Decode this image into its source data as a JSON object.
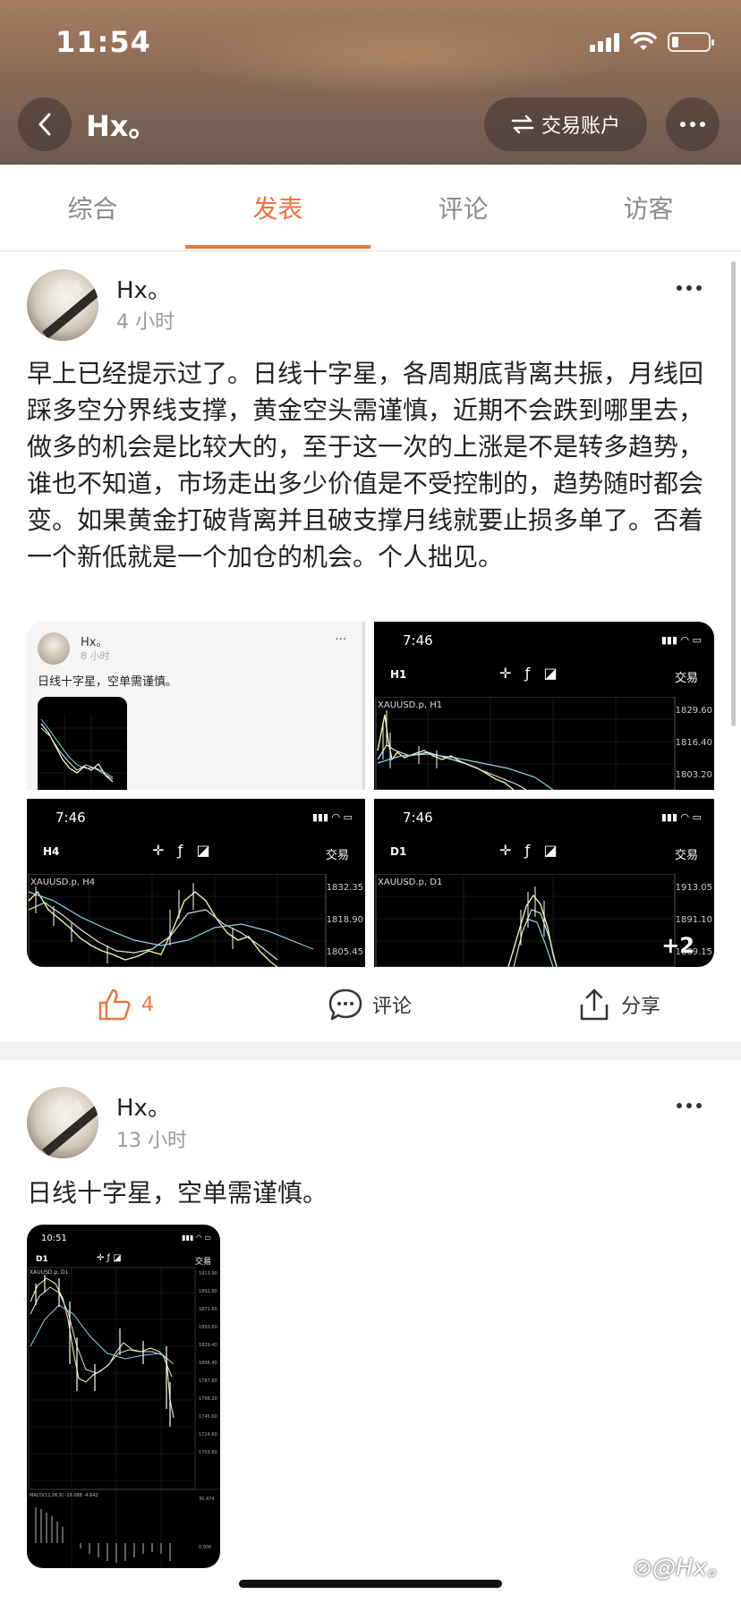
{
  "status_bar": {
    "time": "11:54"
  },
  "header": {
    "title": "Hx。",
    "account_button": "交易账户"
  },
  "tabs": [
    {
      "label": "综合"
    },
    {
      "label": "发表"
    },
    {
      "label": "评论"
    },
    {
      "label": "访客"
    }
  ],
  "active_tab": "发表",
  "posts": [
    {
      "user": "Hx。",
      "time": "4 小时",
      "text": "早上已经提示过了。日线十字星，各周期底背离共振，月线回踩多空分界线支撑，黄金空头需谨慎，近期不会跌到哪里去，做多的机会是比较大的，至于这一次的上涨是不是转多趋势，谁也不知道，市场走出多少价值是不受控制的，趋势随时都会变。如果黄金打破背离并且破支撑月线就要止损多单了。否着一个新低就是一个加仓的机会。个人拙见。",
      "images": [
        {
          "type": "post-screenshot",
          "user": "Hx。",
          "time": "8 小时",
          "text": "日线十字星，空单需谨慎。"
        },
        {
          "type": "chart",
          "clock": "7:46",
          "period": "H1",
          "symbol": "XAUUSD.p, H1",
          "trade": "交易",
          "prices": [
            "1829.60",
            "1816.40",
            "1803.20"
          ]
        },
        {
          "type": "chart",
          "clock": "7:46",
          "period": "H4",
          "symbol": "XAUUSD.p, H4",
          "trade": "交易",
          "prices": [
            "1832.35",
            "1818.90",
            "1805.45"
          ]
        },
        {
          "type": "chart",
          "clock": "7:46",
          "period": "D1",
          "symbol": "XAUUSD.p, D1",
          "trade": "交易",
          "prices": [
            "1913.05",
            "1891.10",
            "1869.15"
          ],
          "more": "+2"
        }
      ],
      "likes": "4",
      "comment_label": "评论",
      "share_label": "分享"
    },
    {
      "user": "Hx。",
      "time": "13 小时",
      "text": "日线十字星，空单需谨慎。",
      "images": [
        {
          "type": "chart",
          "clock": "10:51",
          "period": "D1",
          "symbol": "XAUUSD.p, D1",
          "trade": "交易"
        }
      ]
    }
  ],
  "watermark": "⊘@Hx。",
  "colors": {
    "accent": "#f0743a",
    "chart_bg": "#000000"
  }
}
